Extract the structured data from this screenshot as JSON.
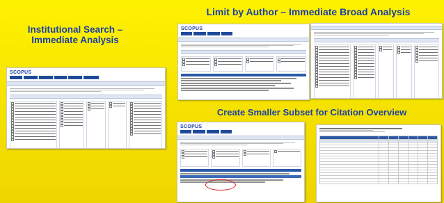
{
  "headings": {
    "institutional_search": "Institutional Search – Immediate Analysis",
    "limit_by_author": "Limit by Author – Immediate Broad Analysis",
    "smaller_subset": "Create Smaller Subset for Citation Overview"
  },
  "logo": "SCOPUS",
  "colors": {
    "background": "#fff200",
    "heading": "#1a3fa8",
    "highlight_circle": "#d11a1a"
  }
}
